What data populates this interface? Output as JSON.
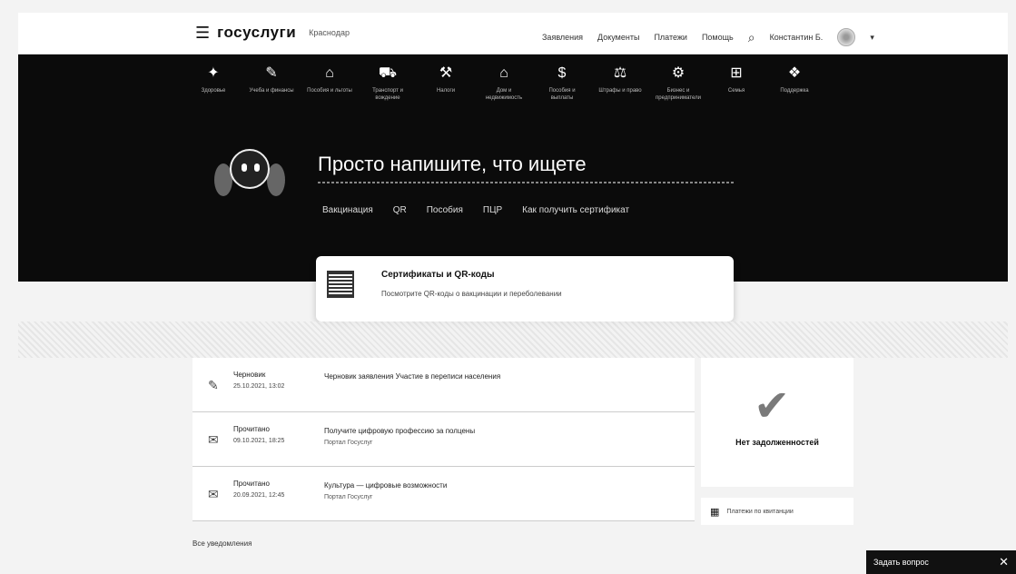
{
  "header": {
    "logo": "госуслуги",
    "region": "Краснодар",
    "nav": [
      "Заявления",
      "Документы",
      "Платежи",
      "Помощь"
    ],
    "account": "Константин Б."
  },
  "categories": [
    {
      "icon": "✦",
      "label": "Здоровье"
    },
    {
      "icon": "✎",
      "label": "Учеба и финансы"
    },
    {
      "icon": "⌂",
      "label": "Пособия и льготы"
    },
    {
      "icon": "⛟",
      "label": "Транспорт и вождение"
    },
    {
      "icon": "⚒",
      "label": "Налоги"
    },
    {
      "icon": "⌂",
      "label": "Дом и недвижимость"
    },
    {
      "icon": "$",
      "label": "Пособия и выплаты"
    },
    {
      "icon": "⚖",
      "label": "Штрафы и право"
    },
    {
      "icon": "⚙",
      "label": "Бизнес и предприниматели"
    },
    {
      "icon": "⊞",
      "label": "Семья"
    },
    {
      "icon": "❖",
      "label": "Поддержка"
    }
  ],
  "hero": {
    "title": "Просто напишите, что ищете",
    "chips": [
      "Вакцинация",
      "QR",
      "Пособия",
      "ПЦР",
      "Как получить сертификат"
    ]
  },
  "qr_card": {
    "title": "Сертификаты и QR-коды",
    "desc": "Посмотрите QR-коды о вакцинации и переболевании"
  },
  "events": [
    {
      "icon": "✎",
      "status": "Черновик",
      "date": "25.10.2021, 13:02",
      "text": "Черновик заявления Участие в переписи населения",
      "sender": ""
    },
    {
      "icon": "✉",
      "status": "Прочитано",
      "date": "09.10.2021, 18:25",
      "text": "Получите цифровую профессию за полцены",
      "sender": "Портал Госуслуг"
    },
    {
      "icon": "✉",
      "status": "Прочитано",
      "date": "20.09.2021, 12:45",
      "text": "Культура — цифровые возможности",
      "sender": "Портал Госуслуг"
    }
  ],
  "debts": {
    "text": "Нет задолженностей"
  },
  "pay_qr": {
    "text": "Платежи по квитанции"
  },
  "notifications": {
    "label": "Все уведомления"
  },
  "ask": {
    "label": "Задать вопрос",
    "close": "✕"
  }
}
